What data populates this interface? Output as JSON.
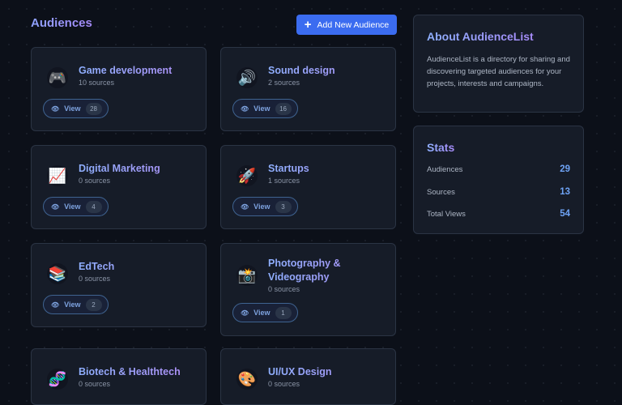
{
  "header": {
    "title": "Audiences",
    "add_button": "Add New Audience"
  },
  "audiences": [
    {
      "name": "Game development",
      "sources": "10 sources",
      "view_label": "View",
      "views": "28",
      "icon": "🎮"
    },
    {
      "name": "Sound design",
      "sources": "2 sources",
      "view_label": "View",
      "views": "16",
      "icon": "🔊"
    },
    {
      "name": "Digital Marketing",
      "sources": "0 sources",
      "view_label": "View",
      "views": "4",
      "icon": "📈"
    },
    {
      "name": "Startups",
      "sources": "1 sources",
      "view_label": "View",
      "views": "3",
      "icon": "🚀"
    },
    {
      "name": "EdTech",
      "sources": "0 sources",
      "view_label": "View",
      "views": "2",
      "icon": "📚"
    },
    {
      "name": "Photography & Videography",
      "sources": "0 sources",
      "view_label": "View",
      "views": "1",
      "icon": "📸"
    },
    {
      "name": "Biotech & Healthtech",
      "sources": "0 sources",
      "icon": "🧬"
    },
    {
      "name": "UI/UX Design",
      "sources": "0 sources",
      "icon": "🎨"
    }
  ],
  "about": {
    "title": "About AudienceList",
    "text": "AudienceList is a directory for sharing and discovering targeted audiences for your projects, interests and campaigns."
  },
  "stats": {
    "title": "Stats",
    "rows": [
      {
        "label": "Audiences",
        "value": "29"
      },
      {
        "label": "Sources",
        "value": "13"
      },
      {
        "label": "Total Views",
        "value": "54"
      }
    ]
  },
  "colors": {
    "accent": "#3b6cf0",
    "background": "#0c1019",
    "card": "#161c28",
    "stat_value": "#6ea3f5"
  }
}
